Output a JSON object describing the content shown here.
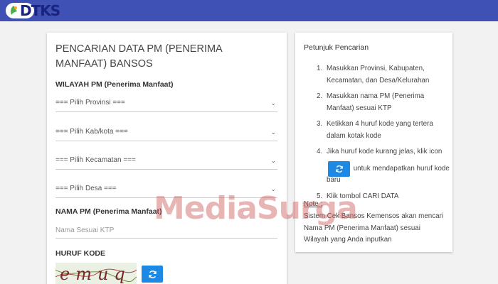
{
  "header": {
    "logo_text": "DTKS",
    "logo_icon": "dtks-logo-icon",
    "bar_color": "#3f51b5"
  },
  "form": {
    "title": "PENCARIAN DATA PM (PENERIMA MANFAAT) BANSOS",
    "wilayah_label": "WILAYAH PM (Penerima Manfaat)",
    "provinsi": "=== Pilih Provinsi ===",
    "kabkota": "=== Pilih Kab/kota ===",
    "kecamatan": "=== Pilih Kecamatan ===",
    "desa": "=== Pilih Desa ===",
    "nama_label": "NAMA PM (Penerima Manfaat)",
    "nama_placeholder": "Nama Sesuai KTP",
    "kode_label": "HURUF KODE",
    "captcha_text": "emuq",
    "refresh_icon": "refresh-icon",
    "button_color": "#1e88e5"
  },
  "guide": {
    "title": "Petunjuk Pencarian",
    "steps": [
      {
        "num": "1.",
        "text": "Masukkan Provinsi, Kabupaten, Kecamatan, dan Desa/Kelurahan"
      },
      {
        "num": "2.",
        "text": "Masukkan nama PM (Penerima Manfaat) sesuai KTP"
      },
      {
        "num": "3.",
        "text": "Ketikkan 4 huruf kode yang tertera dalam kotak kode"
      },
      {
        "num": "4.",
        "before": "Jika huruf kode kurang jelas, klik icon",
        "after": "untuk mendapatkan huruf kode baru"
      },
      {
        "num": "5.",
        "text": "Klik tombol CARI DATA"
      }
    ],
    "note_label": "Note :",
    "note_text": "Sistem Cek Bansos Kemensos akan mencari Nama PM (Penerima Manfaat) sesuai Wilayah yang Anda inputkan"
  },
  "watermark": {
    "text": "MediaSurga"
  }
}
